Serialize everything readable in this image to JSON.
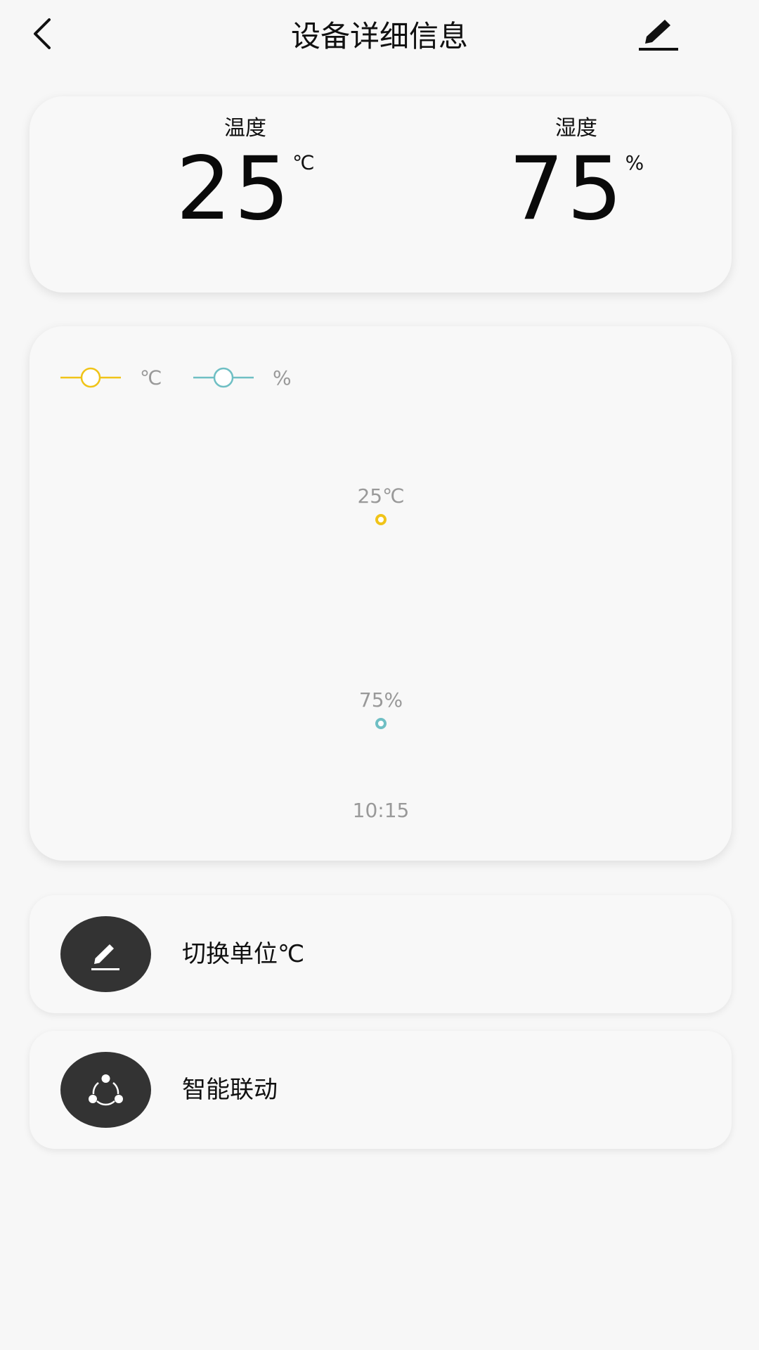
{
  "header": {
    "title": "设备详细信息",
    "back_icon": "chevron-left-icon",
    "edit_icon": "pencil-icon"
  },
  "readings": {
    "temperature": {
      "label": "温度",
      "value": "25",
      "unit": "℃"
    },
    "humidity": {
      "label": "湿度",
      "value": "75",
      "unit": "%"
    }
  },
  "colors": {
    "temperature_series": "#f0c419",
    "humidity_series": "#6fbfc4",
    "icon_circle": "#333333"
  },
  "chart_data": {
    "type": "line",
    "x": [
      "10:15"
    ],
    "series": [
      {
        "name": "℃",
        "values": [
          25
        ],
        "point_labels": [
          "25℃"
        ]
      },
      {
        "name": "%",
        "values": [
          75
        ],
        "point_labels": [
          "75%"
        ]
      }
    ],
    "legend": "top-left",
    "grid": false
  },
  "actions": [
    {
      "label": "切换单位℃",
      "icon": "pencil-icon"
    },
    {
      "label": "智能联动",
      "icon": "share-nodes-icon"
    }
  ]
}
